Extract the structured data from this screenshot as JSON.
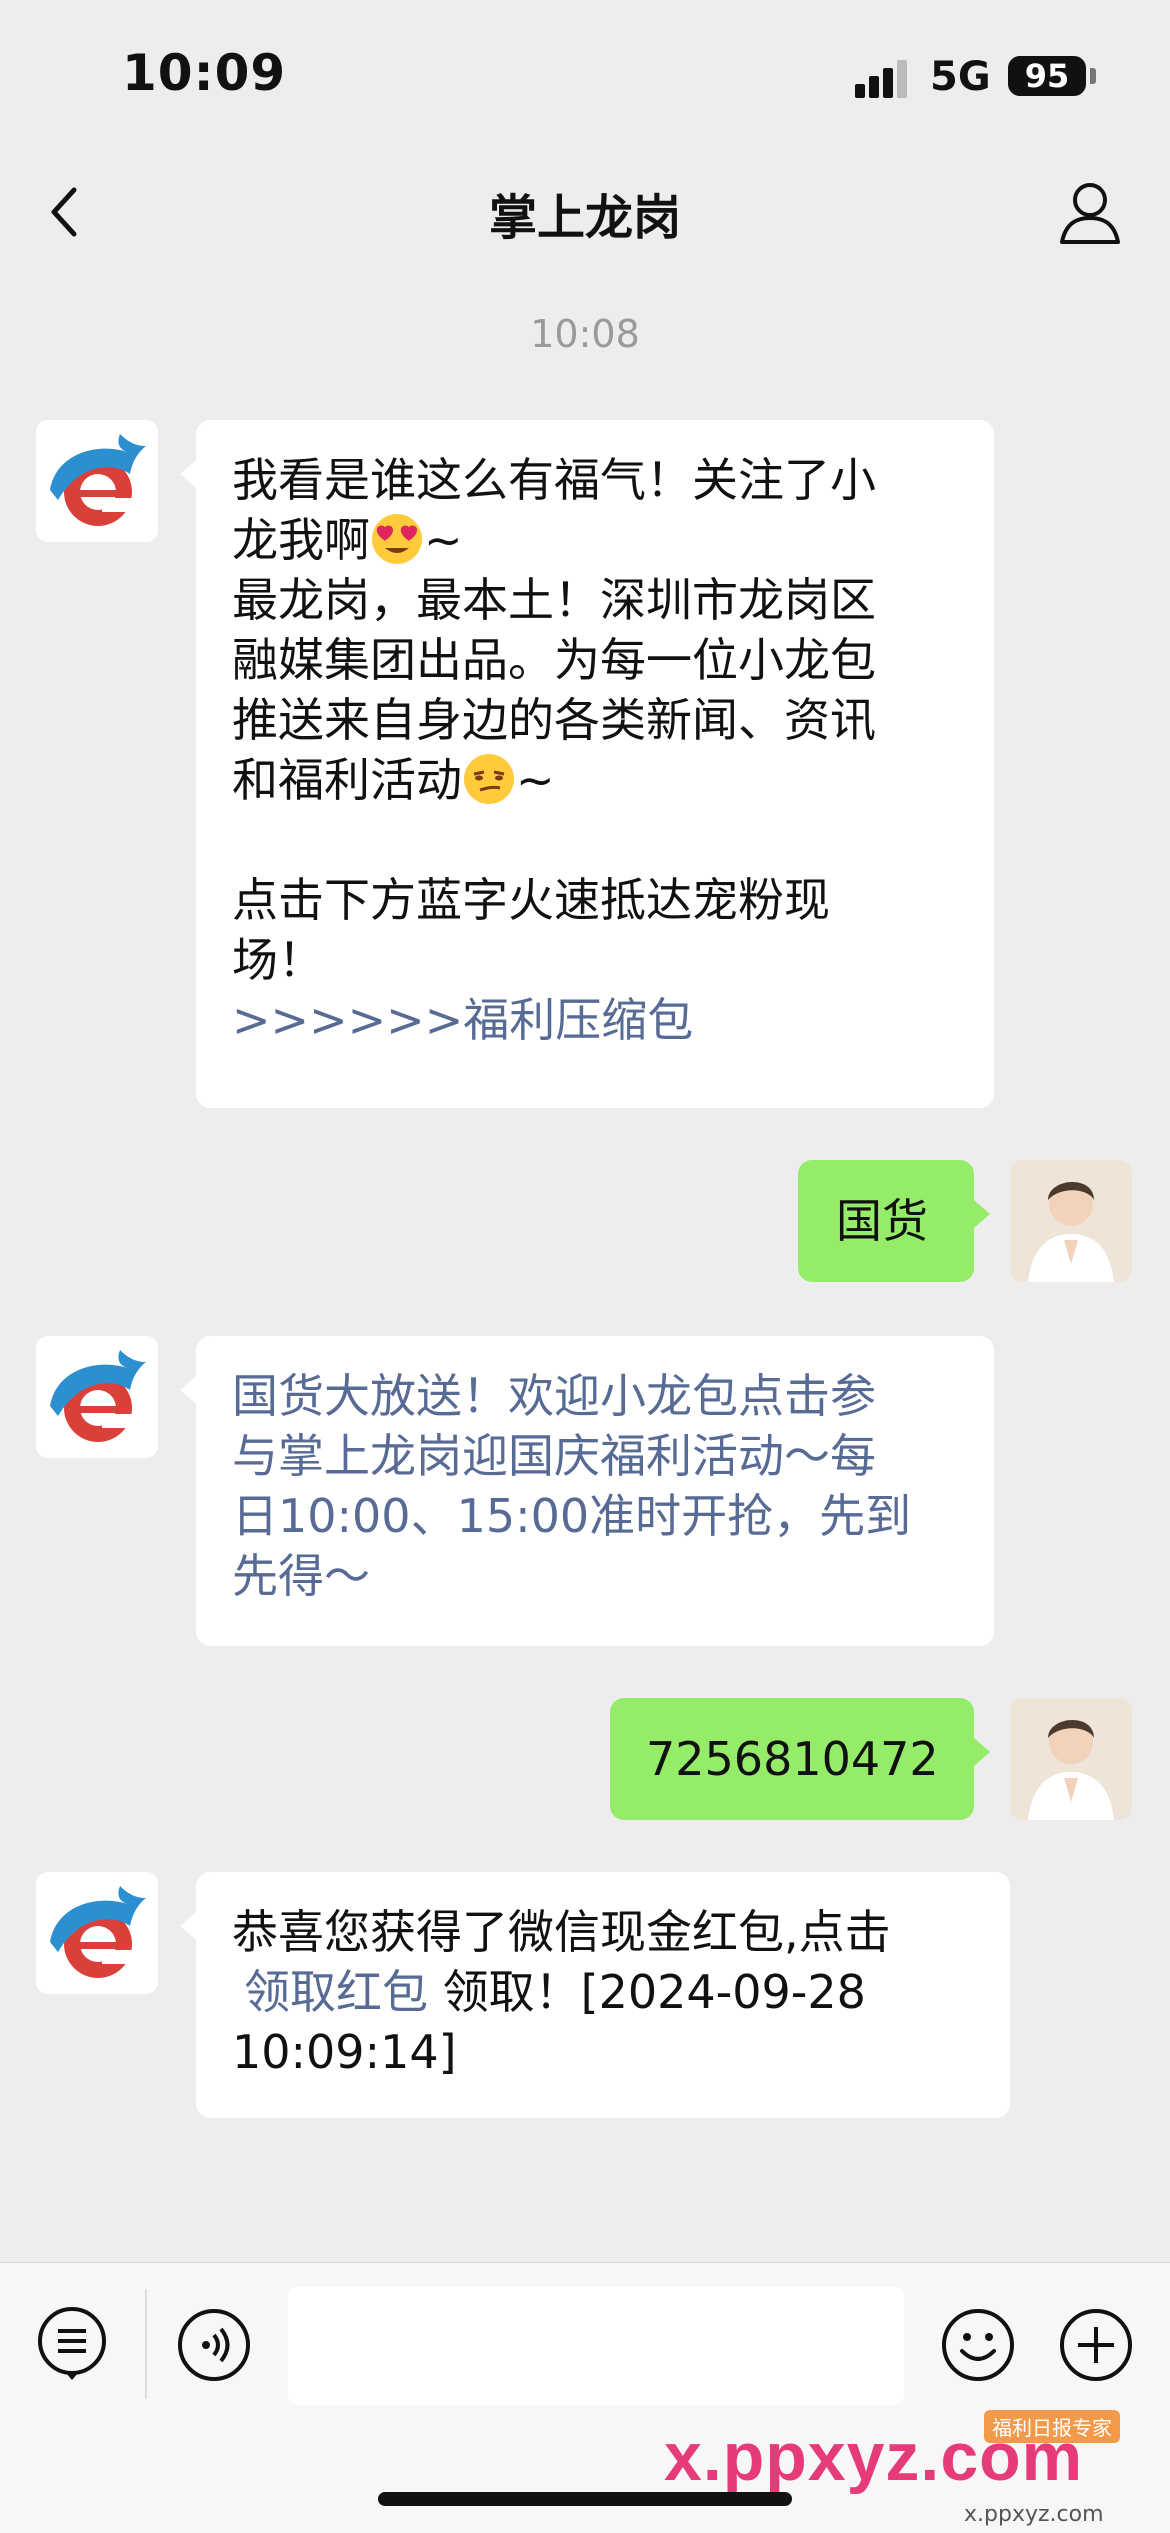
{
  "status_bar": {
    "time": "10:09",
    "network": "5G",
    "battery": "95"
  },
  "header": {
    "title": "掌上龙岗"
  },
  "timestamp": "10:08",
  "messages": [
    {
      "line1": "我看是谁这么有福气！关注了小",
      "line2": "龙我啊",
      "line2_tail": "~",
      "line3": "最龙岗，最本土！深圳市龙岗区",
      "line4": "融媒集团出品。为每一位小龙包",
      "line5": "推送来自身边的各类新闻、资讯",
      "line6": "和福利活动",
      "line6_tail": "~",
      "line7": "点击下方蓝字火速抵达宠粉现",
      "line8": "场！",
      "link": ">>>>>>福利压缩包"
    },
    {
      "text": "国货"
    },
    {
      "line1": "国货大放送！欢迎小龙包点击参",
      "line2": "与掌上龙岗迎国庆福利活动～每",
      "line3": "日10:00、15:00准时开抢，先到",
      "line4": "先得～"
    },
    {
      "text": "7256810472"
    },
    {
      "line1": "恭喜您获得了微信现金红包,点击",
      "link": "领取红包",
      "line2_tail": " 领取！[2024-09-28",
      "line3": "10:09:14]"
    }
  ],
  "watermark": {
    "main": "x.ppxyz.com",
    "sub": "x.ppxyz.com",
    "badge": "福利日报专家"
  },
  "icons": [
    "back-icon",
    "profile-icon",
    "list-menu-icon",
    "voice-icon",
    "emoji-icon",
    "plus-icon"
  ],
  "colors": {
    "background": "#ededed",
    "outgoing_bubble": "#95ec69",
    "link": "#576b95"
  }
}
